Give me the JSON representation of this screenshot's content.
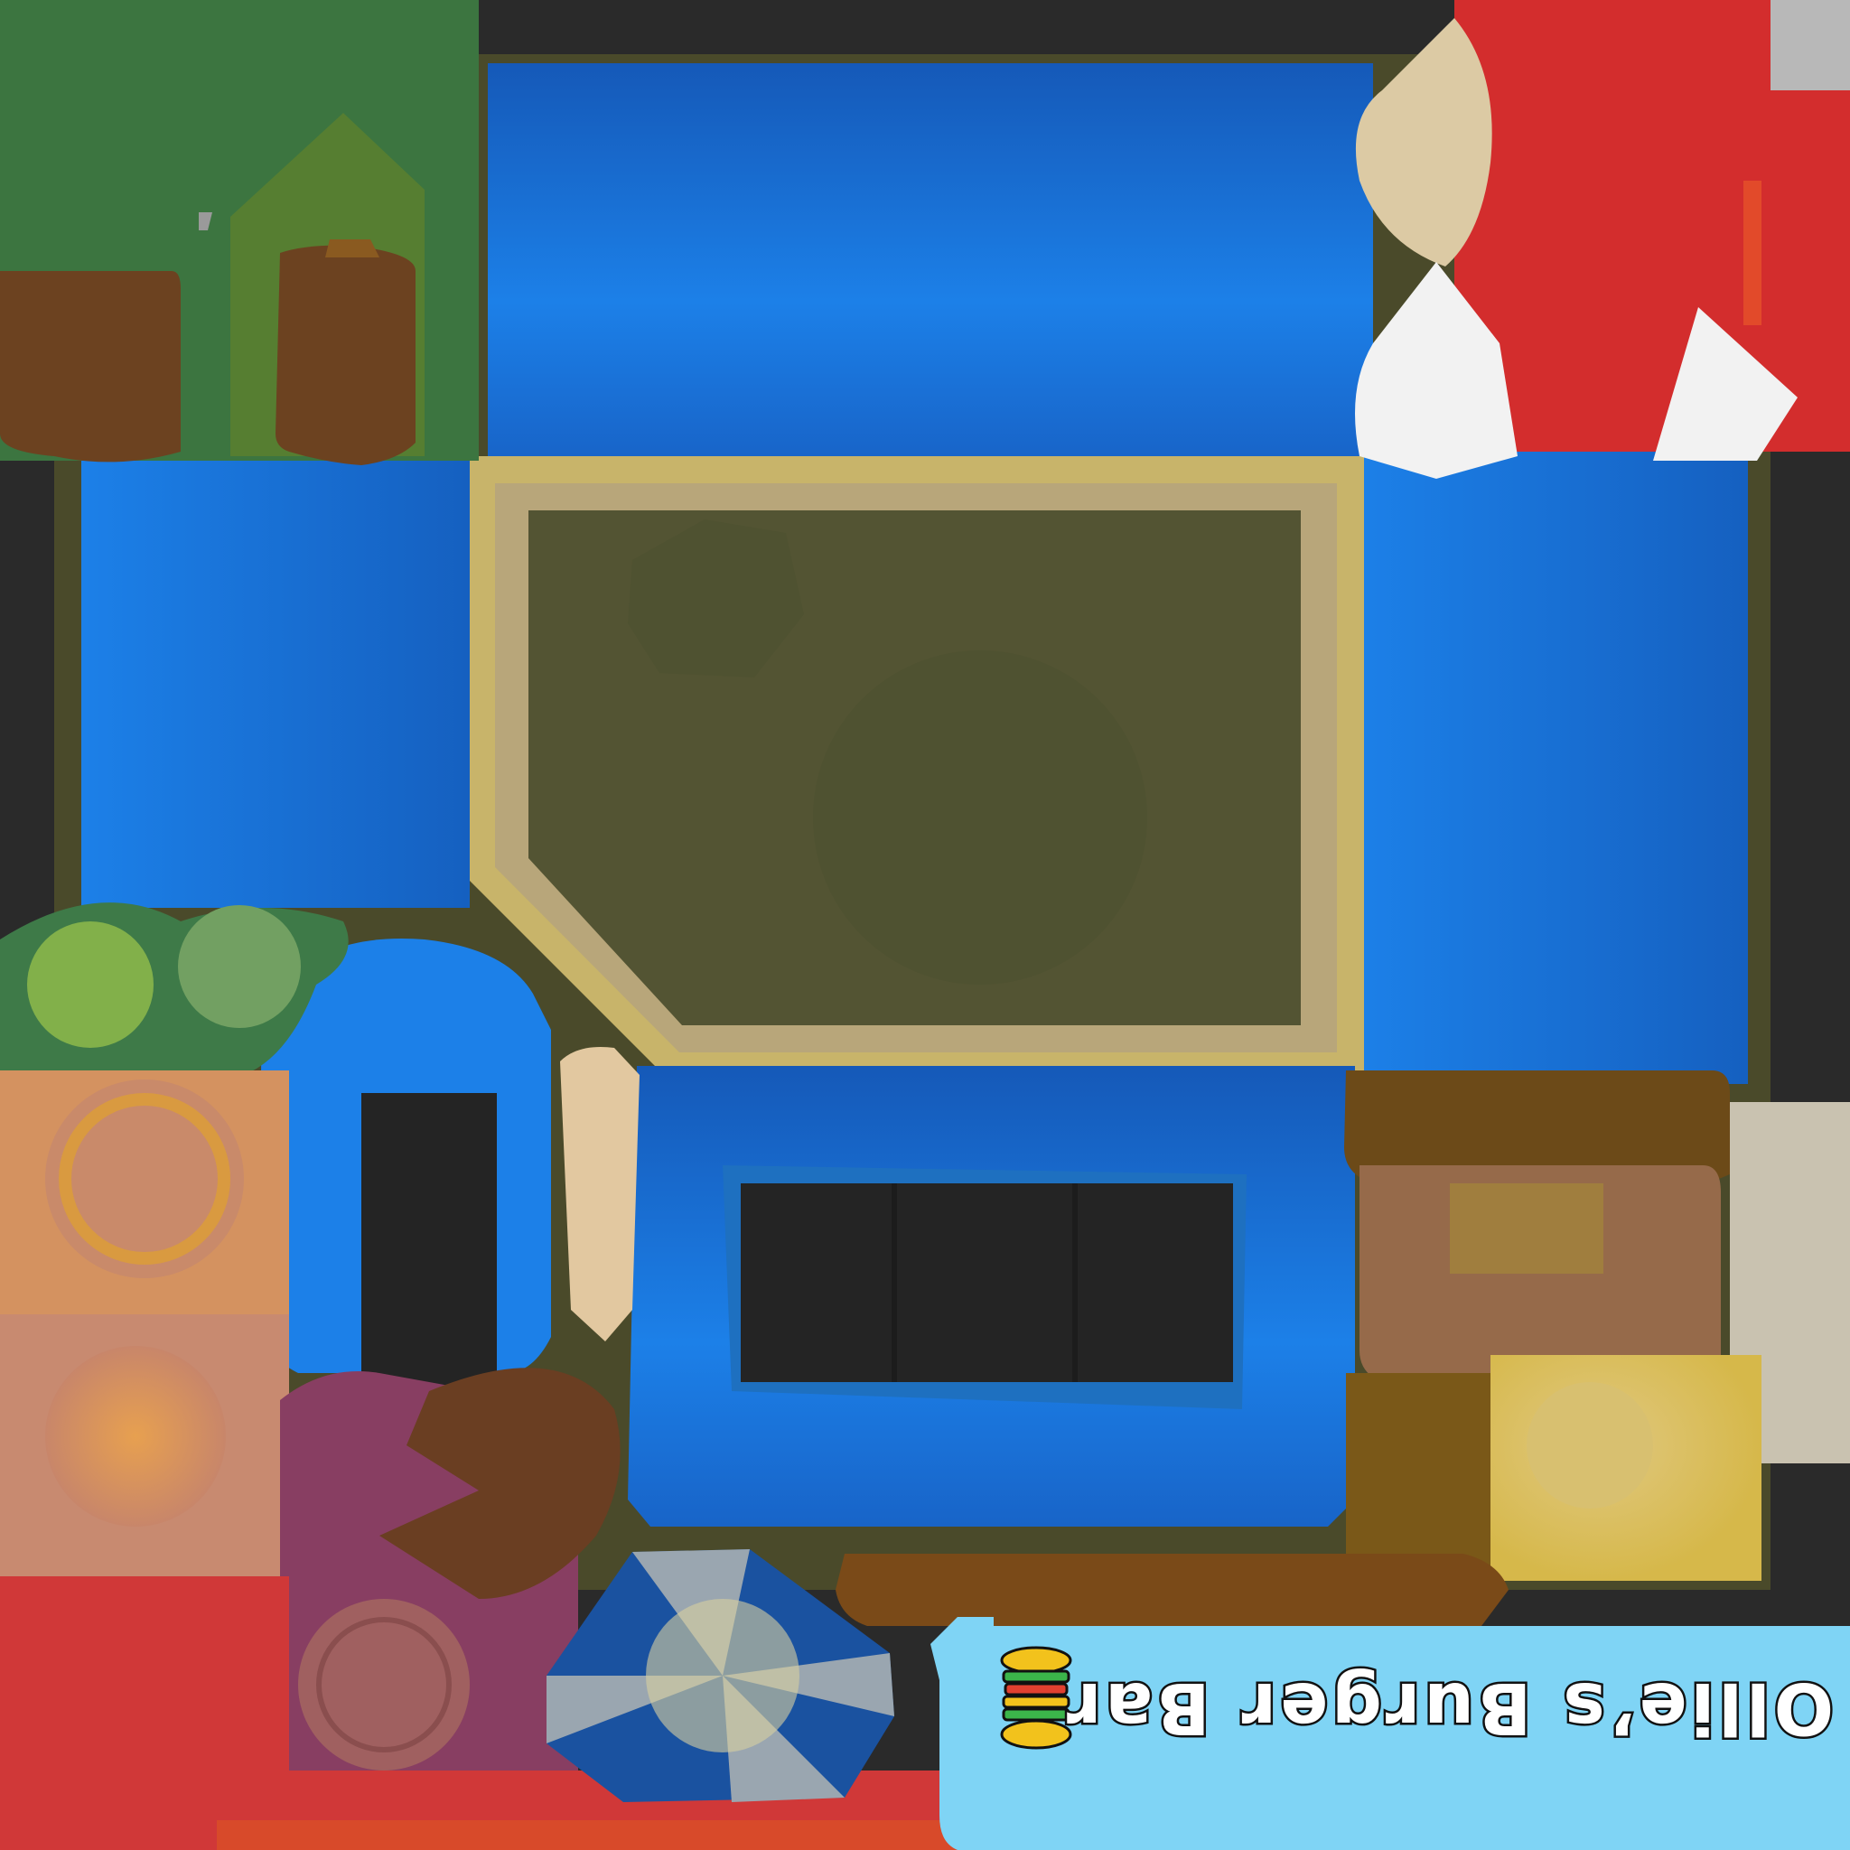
{
  "sign": {
    "label": "Ollie’s Burger Bar",
    "icon": "burger-icon"
  },
  "colors": {
    "background": "#2a2a2a",
    "blue_panel": "#1a78e0",
    "tan_frame": "#c8b46a",
    "olive_window": "#535433",
    "green_tree": "#3c7540",
    "brown_wood": "#6c4220",
    "red": "#d32d2d",
    "sign_bg": "#7fd4f5"
  }
}
